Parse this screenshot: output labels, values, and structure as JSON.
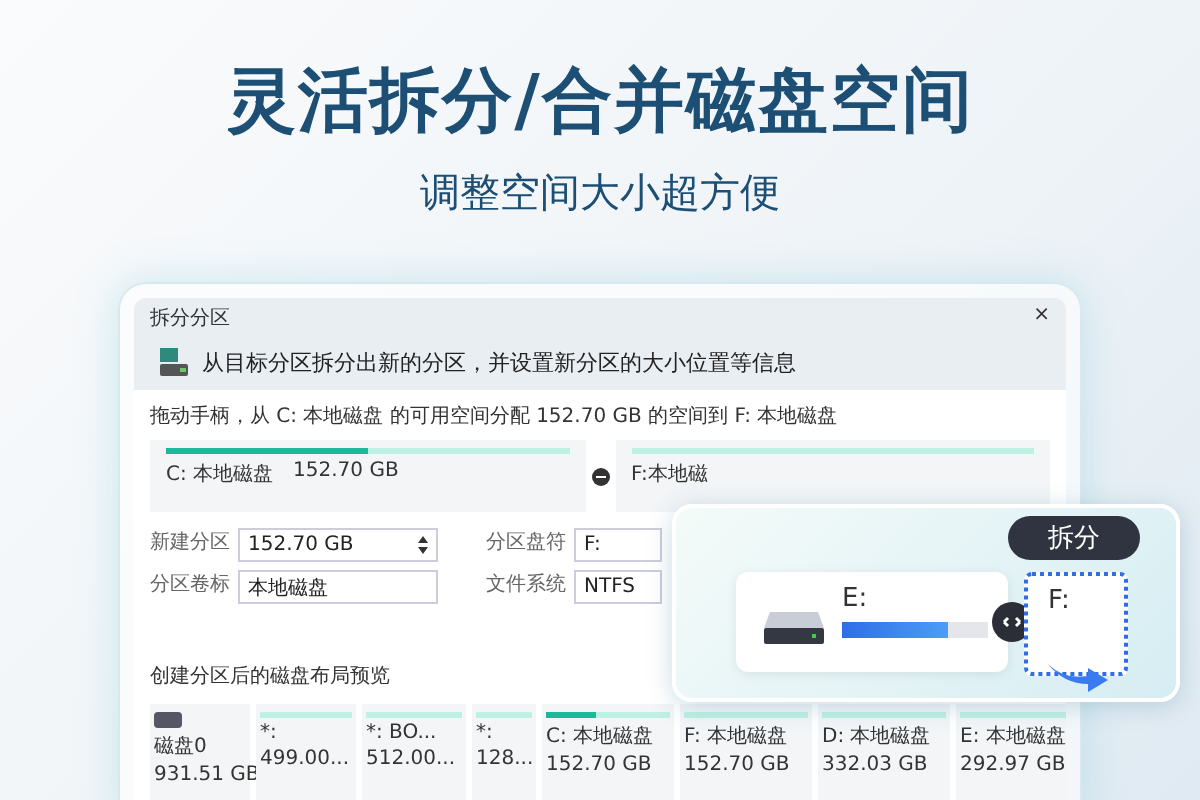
{
  "headline": "灵活拆分/合并磁盘空间",
  "subheadline": "调整空间大小超方便",
  "window": {
    "title": "拆分分区",
    "close": "×",
    "header": "从目标分区拆分出新的分区，并设置新分区的大小位置等信息"
  },
  "instruction": "拖动手柄，从 C: 本地磁盘 的可用空间分配 152.70 GB 的空间到 F: 本地磁盘",
  "split_cards": [
    {
      "name": "C: 本地磁盘",
      "size": "152.70 GB",
      "level": 0.5
    },
    {
      "name": "F:本地磁"
    }
  ],
  "form": [
    {
      "label": "新建分区",
      "value": "152.70 GB",
      "kind": "spinner"
    },
    {
      "label": "分区盘符",
      "value": "F:",
      "kind": "text"
    },
    {
      "label": "分区卷标",
      "value": "本地磁盘",
      "kind": "text"
    },
    {
      "label": "文件系统",
      "value": "NTFS",
      "kind": "text"
    }
  ],
  "preview_title": "创建分区后的磁盘布局预览",
  "tiles": [
    {
      "kind": "disk",
      "name": "磁盘0",
      "size": "931.51 GB"
    },
    {
      "kind": "partition",
      "name": "*:",
      "size": "499.00..."
    },
    {
      "kind": "partition",
      "name": "*: BO...",
      "size": "512.00..."
    },
    {
      "kind": "partition",
      "name": "*:",
      "size": "128..."
    },
    {
      "kind": "partition",
      "name": "C: 本地磁盘",
      "size": "152.70 GB",
      "level": 0.4
    },
    {
      "kind": "partition",
      "name": "F: 本地磁盘",
      "size": "152.70 GB"
    },
    {
      "kind": "partition",
      "name": "D: 本地磁盘",
      "size": "332.03 GB"
    },
    {
      "kind": "partition",
      "name": "E: 本地磁盘",
      "size": "292.97 GB"
    }
  ],
  "callout": {
    "badge": "拆分",
    "source": {
      "name": "E:",
      "level": 0.72
    },
    "target": {
      "name": "F:"
    }
  }
}
